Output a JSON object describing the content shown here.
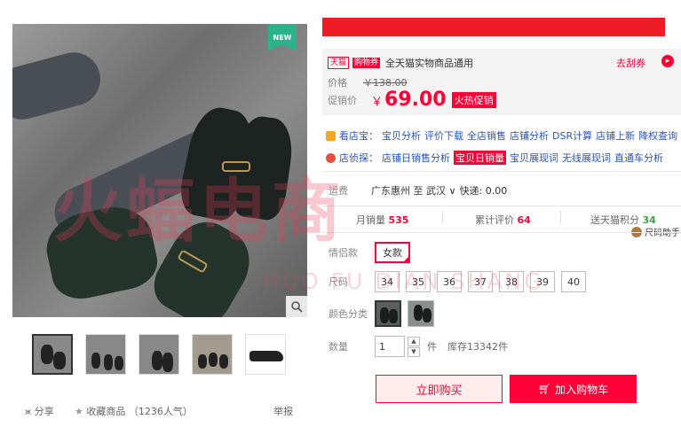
{
  "gallery": {
    "badge": "NEW",
    "zoom_icon": "magnifier-icon",
    "thumbnail_count": 5
  },
  "actions": {
    "share": "分享",
    "favorite": "收藏商品",
    "popularity": "（1236人气）",
    "report": "举报"
  },
  "price": {
    "tmall_tag": "天猫",
    "coupon_tag": "购物券",
    "coupon_text": "全天猫实物商品通用",
    "get_coupon": "去刮券",
    "orig_label": "价格",
    "orig_value": "￥138.00",
    "promo_label": "促销价",
    "currency": "￥",
    "promo_value": "69.00",
    "promo_tag": "火热促销"
  },
  "tools": {
    "kandianbao_label": "看店宝：",
    "kandianbao_links": [
      "宝贝分析",
      "评价下载",
      "全店销售",
      "店铺分析",
      "DSR计算",
      "店铺上新",
      "降权查询"
    ],
    "dianzhentan_label": "店侦探：",
    "dianzhentan_links": [
      "店铺日销售分析",
      "宝贝日销量",
      "宝贝展现词",
      "无线展现词",
      "直通车分析"
    ]
  },
  "shipping": {
    "label": "运费",
    "route": "广东惠州 至 武汉",
    "fee": "快递: 0.00"
  },
  "stats": {
    "monthly_label": "月销量",
    "monthly_value": "535",
    "review_label": "累计评价",
    "review_value": "64",
    "points_label": "送天猫积分",
    "points_value": "34",
    "size_helper": "尺码助手"
  },
  "selection": {
    "style_label": "情侣款",
    "style_option": "女款",
    "size_label": "尺码",
    "sizes": [
      "34",
      "35",
      "36",
      "37",
      "38",
      "39",
      "40"
    ],
    "color_label": "颜色分类",
    "qty_label": "数量",
    "qty_value": "1",
    "qty_unit": "件",
    "stock": "库存13342件"
  },
  "buttons": {
    "buy_now": "立即购买",
    "add_cart": "加入购物车"
  },
  "watermark": {
    "main": "火蝠电商",
    "sub": "HUO FU DIAN SHANG"
  },
  "colors": {
    "accent": "#ff0036",
    "link": "#2952c5",
    "title_bar": "#ee1c25"
  }
}
